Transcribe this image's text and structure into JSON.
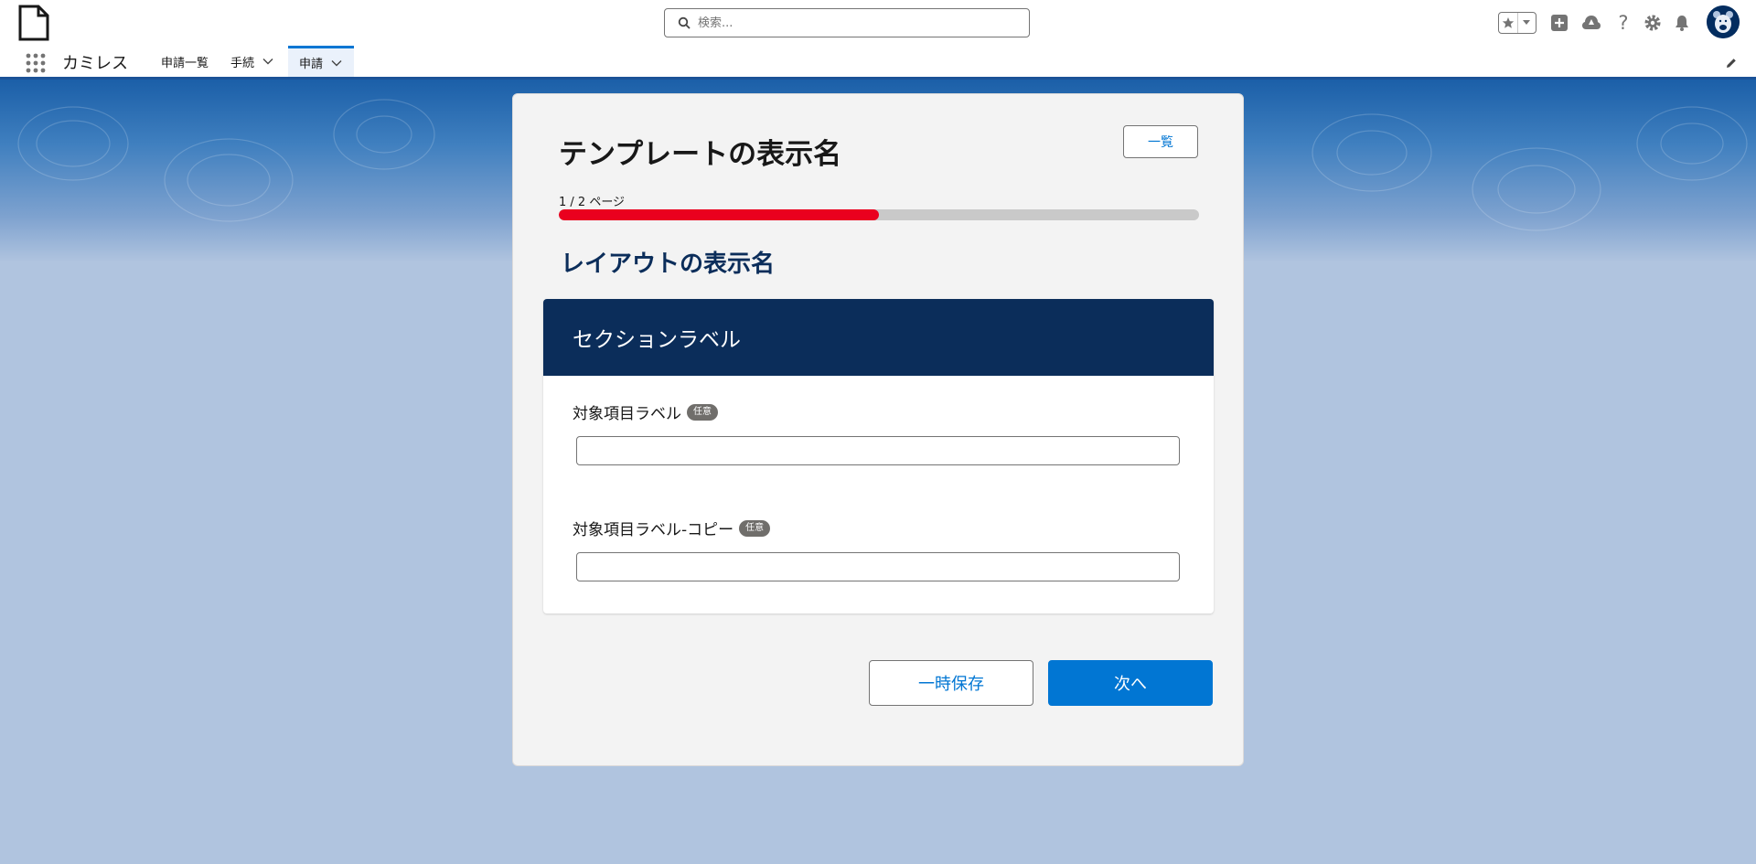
{
  "header": {
    "search_placeholder": "検索..."
  },
  "nav": {
    "app_name": "カミレス",
    "items": [
      {
        "label": "申請一覧"
      },
      {
        "label": "手続"
      },
      {
        "label": "申請"
      }
    ]
  },
  "form": {
    "title": "テンプレートの表示名",
    "list_button": "一覧",
    "progress_label": "1 / 2 ページ",
    "progress_fraction": 0.5,
    "layout_title": "レイアウトの表示名",
    "section_label": "セクションラベル",
    "fields": [
      {
        "label": "対象項目ラベル",
        "badge": "任意",
        "value": ""
      },
      {
        "label": "対象項目ラベル-コピー",
        "badge": "任意",
        "value": ""
      }
    ],
    "save_button": "一時保存",
    "next_button": "次へ"
  },
  "colors": {
    "brand": "#0176d3",
    "progress": "#ea001e",
    "section_header": "#0b2d5a",
    "page_background": "#b0c4df"
  }
}
